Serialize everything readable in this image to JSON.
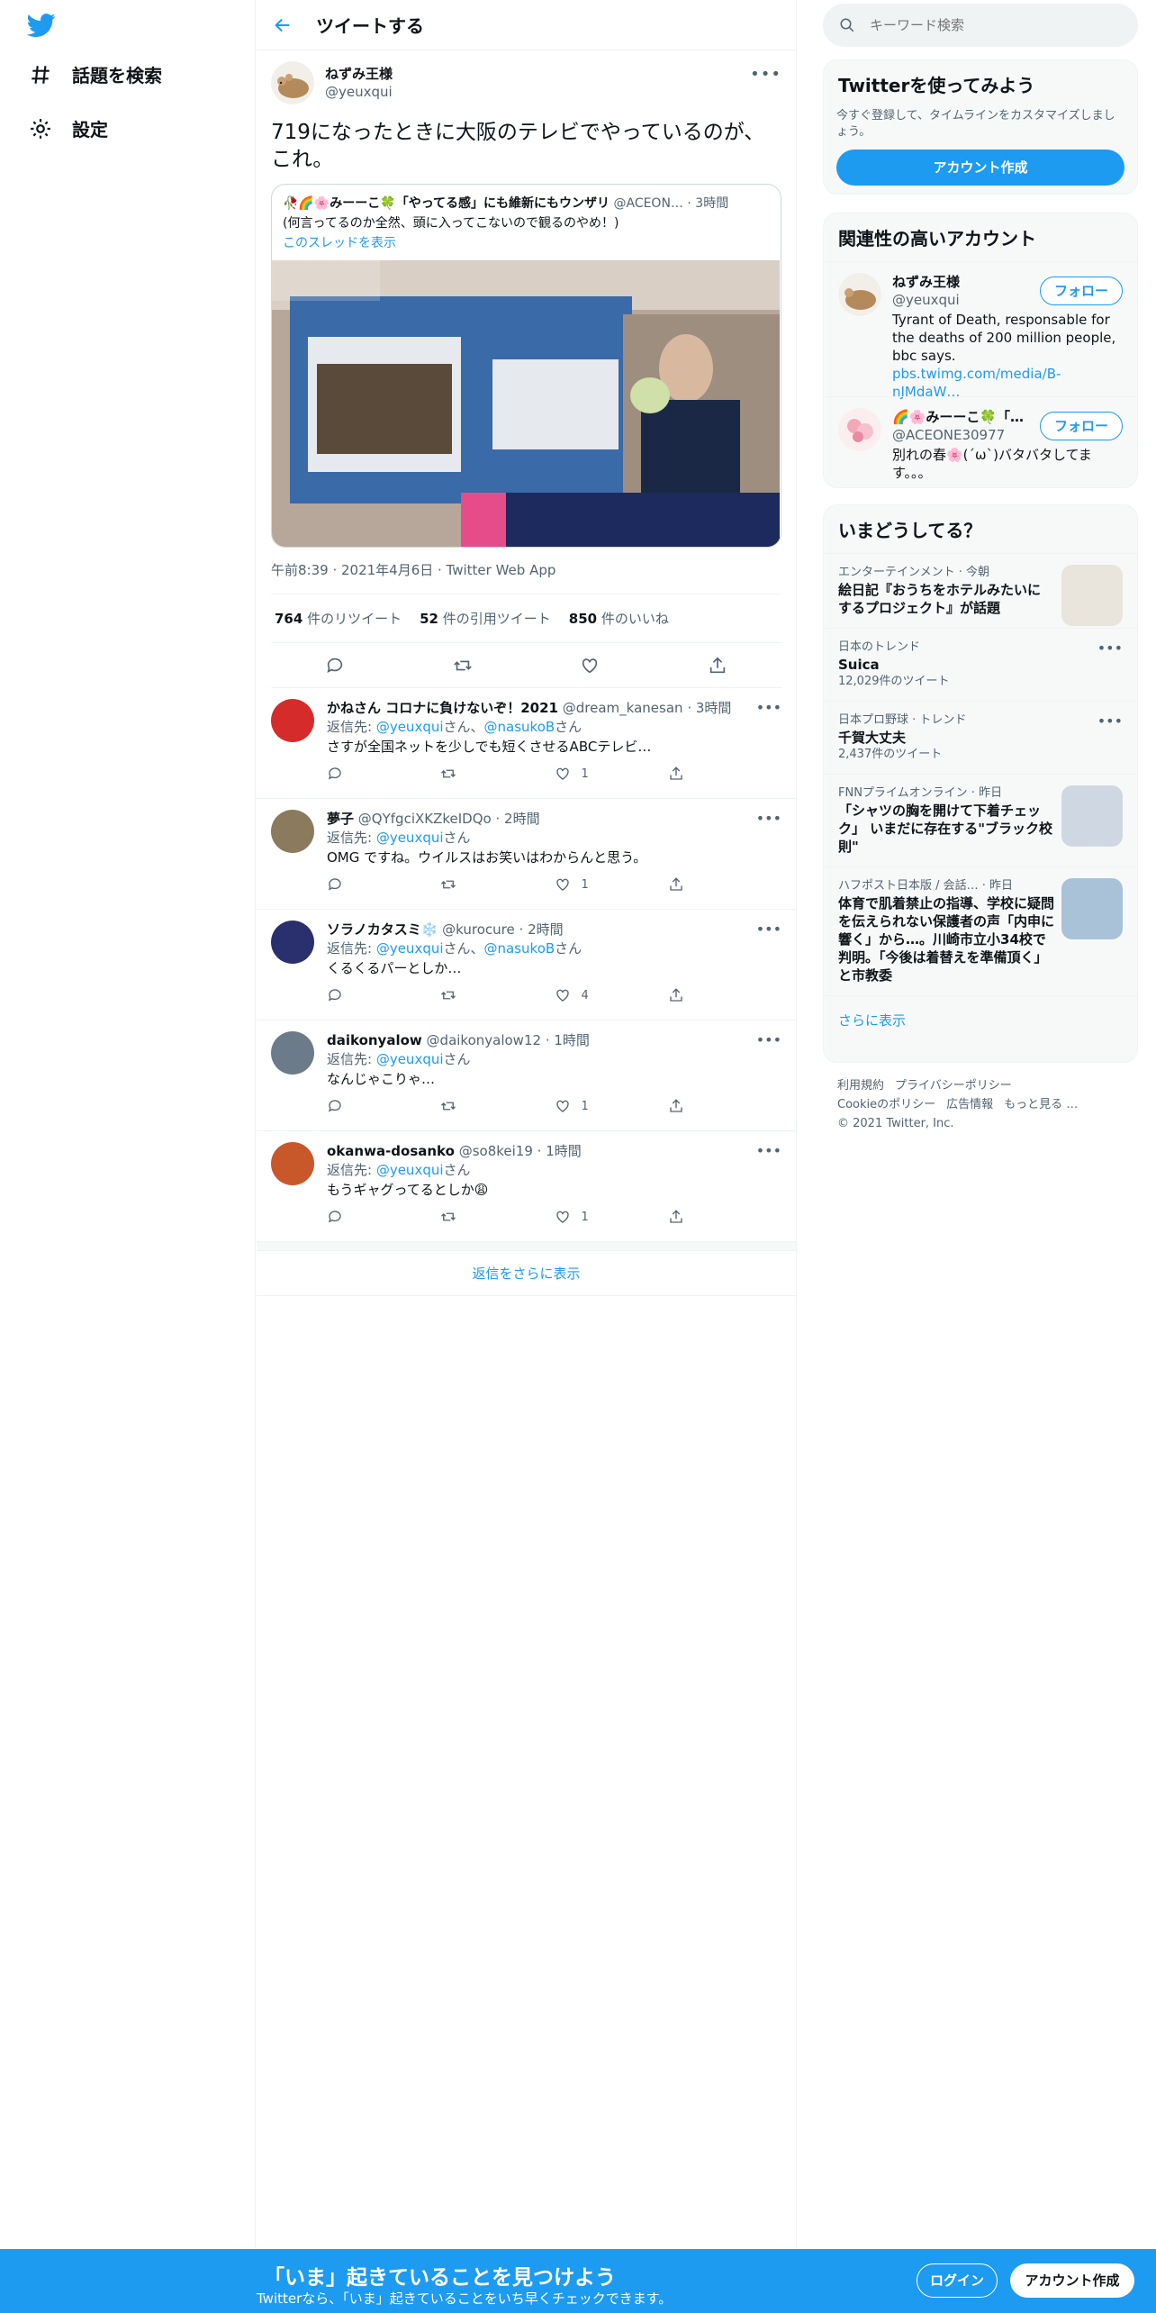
{
  "nav": {
    "explore_label": "話題を検索",
    "settings_label": "設定"
  },
  "header": {
    "title": "ツイートする"
  },
  "tweet": {
    "name": "ねずみ王様",
    "handle": "@yeuxqui",
    "text": "719になったときに大阪のテレビでやっているのが、これ。",
    "quote": {
      "name": "🥀🌈🌸みーーこ🍀「やってる感」にも維新にもウンザリ",
      "handle": "@ACEON…",
      "time": "· 3時間",
      "text": "(何言ってるのか全然、頭に入ってこないので観るのやめ！)",
      "thread_link": "このスレッドを表示"
    },
    "meta": "午前8:39 · 2021年4月6日 · Twitter Web App",
    "retweets_count": "764",
    "retweets_label": "件のリツイート",
    "quotes_count": "52",
    "quotes_label": "件の引用ツイート",
    "likes_count": "850",
    "likes_label": "件のいいね"
  },
  "replies": [
    {
      "name": "かねさん コロナに負けないぞ！2021",
      "handle": "@dream_kanesan",
      "time": "· 3時間",
      "reply_to": "返信先: ",
      "mention1": "@yeuxqui",
      "mid": "さん、",
      "mention2": "@nasukoB",
      "suffix": "さん",
      "text": "さすが全国ネットを少しでも短くさせるABCテレビ…",
      "likes": "1",
      "avatar_color": "#d62b2b"
    },
    {
      "name": "夢子",
      "handle": "@QYfgciXKZkeIDQo",
      "time": "· 2時間",
      "reply_to": "返信先: ",
      "mention1": "@yeuxqui",
      "mid": "さん",
      "mention2": "",
      "suffix": "",
      "text": "OMG ですね。ウイルスはお笑いはわからんと思う。",
      "likes": "1",
      "avatar_color": "#8a7a5e"
    },
    {
      "name": "ソラノカタスミ❄️",
      "handle": "@kurocure",
      "time": "· 2時間",
      "reply_to": "返信先: ",
      "mention1": "@yeuxqui",
      "mid": "さん、",
      "mention2": "@nasukoB",
      "suffix": "さん",
      "text": "くるくるパーとしか…",
      "likes": "4",
      "avatar_color": "#2a2f6e"
    },
    {
      "name": "daikonyalow",
      "handle": "@daikonyalow12",
      "time": "· 1時間",
      "reply_to": "返信先: ",
      "mention1": "@yeuxqui",
      "mid": "さん",
      "mention2": "",
      "suffix": "",
      "text": "なんじゃこりゃ…",
      "likes": "1",
      "avatar_color": "#6b7b8a"
    },
    {
      "name": "okanwa-dosanko",
      "handle": "@so8kei19",
      "time": "· 1時間",
      "reply_to": "返信先: ",
      "mention1": "@yeuxqui",
      "mid": "さん",
      "mention2": "",
      "suffix": "",
      "text": "もうギャグってるとしか😩",
      "likes": "1",
      "avatar_color": "#c8572a"
    }
  ],
  "show_more_replies": "返信をさらに表示",
  "search": {
    "placeholder": "キーワード検索"
  },
  "signup_card": {
    "title": "Twitterを使ってみよう",
    "subtitle": "今すぐ登録して、タイムラインをカスタマイズしましょう。",
    "button": "アカウント作成"
  },
  "related": {
    "title": "関連性の高いアカウント",
    "accounts": [
      {
        "name": "ねずみ王様",
        "handle": "@yeuxqui",
        "bio": "Tyrant of Death, responsable for the deaths of 200 million people, bbc says. ",
        "bio_link": "pbs.twimg.com/media/B-nJMdaW…",
        "follow": "フォロー"
      },
      {
        "name": "🌈🌸みーーこ🍀「…",
        "handle": "@ACEONE30977",
        "bio": "別れの春🌸(´ω`)バタバタしてます。。。",
        "bio_link": "",
        "follow": "フォロー"
      }
    ]
  },
  "trends": {
    "title": "いまどうしてる？",
    "items": [
      {
        "context": "エンターテインメント · 今朝",
        "name": "絵日記『おうちをホテルみたいにするプロジェクト』が話題",
        "count": "",
        "has_image": true
      },
      {
        "context": "日本のトレンド",
        "name": "Suica",
        "count": "12,029件のツイート",
        "has_image": false
      },
      {
        "context": "日本プロ野球 · トレンド",
        "name": "千賀大丈夫",
        "count": "2,437件のツイート",
        "has_image": false
      },
      {
        "context": "FNNプライムオンライン · 昨日",
        "name": "「シャツの胸を開けて下着チェック」 いまだに存在する\"ブラック校則\"",
        "count": "",
        "has_image": true
      },
      {
        "context": "ハフポスト日本版 / 会話… · 昨日",
        "name": "体育で肌着禁止の指導、学校に疑問を伝えられない保護者の声「内申に響く」から…。川崎市立小34校で判明。「今後は着替えを準備頂く」と市教委",
        "count": "",
        "has_image": true
      }
    ],
    "show_more": "さらに表示"
  },
  "footer": {
    "terms": "利用規約",
    "privacy": "プライバシーポリシー",
    "cookie": "Cookieのポリシー",
    "ads": "広告情報",
    "more": "もっと見る …",
    "copyright": "© 2021 Twitter, Inc."
  },
  "bottom_bar": {
    "title": "「いま」起きていることを見つけよう",
    "subtitle": "Twitterなら、「いま」起きていることをいち早くチェックできます。",
    "login": "ログイン",
    "signup": "アカウント作成"
  }
}
